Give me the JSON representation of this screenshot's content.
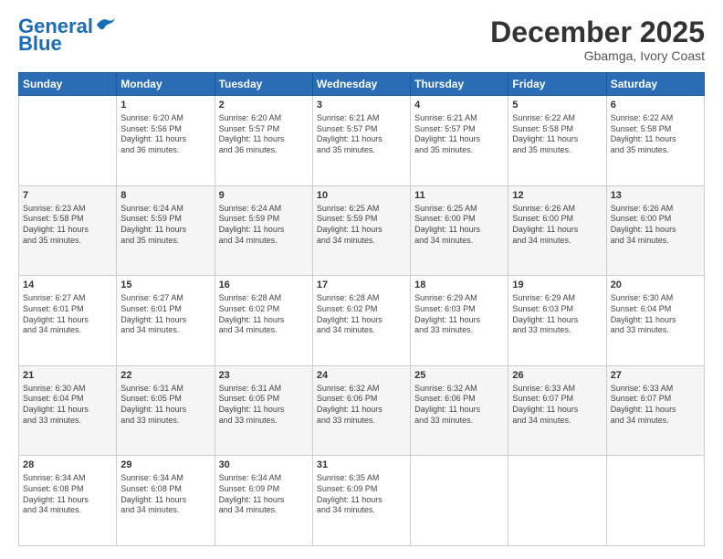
{
  "header": {
    "logo_line1": "General",
    "logo_line2": "Blue",
    "month": "December 2025",
    "location": "Gbamga, Ivory Coast"
  },
  "weekdays": [
    "Sunday",
    "Monday",
    "Tuesday",
    "Wednesday",
    "Thursday",
    "Friday",
    "Saturday"
  ],
  "weeks": [
    [
      {
        "day": "",
        "info": ""
      },
      {
        "day": "1",
        "info": "Sunrise: 6:20 AM\nSunset: 5:56 PM\nDaylight: 11 hours\nand 36 minutes."
      },
      {
        "day": "2",
        "info": "Sunrise: 6:20 AM\nSunset: 5:57 PM\nDaylight: 11 hours\nand 36 minutes."
      },
      {
        "day": "3",
        "info": "Sunrise: 6:21 AM\nSunset: 5:57 PM\nDaylight: 11 hours\nand 35 minutes."
      },
      {
        "day": "4",
        "info": "Sunrise: 6:21 AM\nSunset: 5:57 PM\nDaylight: 11 hours\nand 35 minutes."
      },
      {
        "day": "5",
        "info": "Sunrise: 6:22 AM\nSunset: 5:58 PM\nDaylight: 11 hours\nand 35 minutes."
      },
      {
        "day": "6",
        "info": "Sunrise: 6:22 AM\nSunset: 5:58 PM\nDaylight: 11 hours\nand 35 minutes."
      }
    ],
    [
      {
        "day": "7",
        "info": "Sunrise: 6:23 AM\nSunset: 5:58 PM\nDaylight: 11 hours\nand 35 minutes."
      },
      {
        "day": "8",
        "info": "Sunrise: 6:24 AM\nSunset: 5:59 PM\nDaylight: 11 hours\nand 35 minutes."
      },
      {
        "day": "9",
        "info": "Sunrise: 6:24 AM\nSunset: 5:59 PM\nDaylight: 11 hours\nand 34 minutes."
      },
      {
        "day": "10",
        "info": "Sunrise: 6:25 AM\nSunset: 5:59 PM\nDaylight: 11 hours\nand 34 minutes."
      },
      {
        "day": "11",
        "info": "Sunrise: 6:25 AM\nSunset: 6:00 PM\nDaylight: 11 hours\nand 34 minutes."
      },
      {
        "day": "12",
        "info": "Sunrise: 6:26 AM\nSunset: 6:00 PM\nDaylight: 11 hours\nand 34 minutes."
      },
      {
        "day": "13",
        "info": "Sunrise: 6:26 AM\nSunset: 6:00 PM\nDaylight: 11 hours\nand 34 minutes."
      }
    ],
    [
      {
        "day": "14",
        "info": "Sunrise: 6:27 AM\nSunset: 6:01 PM\nDaylight: 11 hours\nand 34 minutes."
      },
      {
        "day": "15",
        "info": "Sunrise: 6:27 AM\nSunset: 6:01 PM\nDaylight: 11 hours\nand 34 minutes."
      },
      {
        "day": "16",
        "info": "Sunrise: 6:28 AM\nSunset: 6:02 PM\nDaylight: 11 hours\nand 34 minutes."
      },
      {
        "day": "17",
        "info": "Sunrise: 6:28 AM\nSunset: 6:02 PM\nDaylight: 11 hours\nand 34 minutes."
      },
      {
        "day": "18",
        "info": "Sunrise: 6:29 AM\nSunset: 6:03 PM\nDaylight: 11 hours\nand 33 minutes."
      },
      {
        "day": "19",
        "info": "Sunrise: 6:29 AM\nSunset: 6:03 PM\nDaylight: 11 hours\nand 33 minutes."
      },
      {
        "day": "20",
        "info": "Sunrise: 6:30 AM\nSunset: 6:04 PM\nDaylight: 11 hours\nand 33 minutes."
      }
    ],
    [
      {
        "day": "21",
        "info": "Sunrise: 6:30 AM\nSunset: 6:04 PM\nDaylight: 11 hours\nand 33 minutes."
      },
      {
        "day": "22",
        "info": "Sunrise: 6:31 AM\nSunset: 6:05 PM\nDaylight: 11 hours\nand 33 minutes."
      },
      {
        "day": "23",
        "info": "Sunrise: 6:31 AM\nSunset: 6:05 PM\nDaylight: 11 hours\nand 33 minutes."
      },
      {
        "day": "24",
        "info": "Sunrise: 6:32 AM\nSunset: 6:06 PM\nDaylight: 11 hours\nand 33 minutes."
      },
      {
        "day": "25",
        "info": "Sunrise: 6:32 AM\nSunset: 6:06 PM\nDaylight: 11 hours\nand 33 minutes."
      },
      {
        "day": "26",
        "info": "Sunrise: 6:33 AM\nSunset: 6:07 PM\nDaylight: 11 hours\nand 34 minutes."
      },
      {
        "day": "27",
        "info": "Sunrise: 6:33 AM\nSunset: 6:07 PM\nDaylight: 11 hours\nand 34 minutes."
      }
    ],
    [
      {
        "day": "28",
        "info": "Sunrise: 6:34 AM\nSunset: 6:08 PM\nDaylight: 11 hours\nand 34 minutes."
      },
      {
        "day": "29",
        "info": "Sunrise: 6:34 AM\nSunset: 6:08 PM\nDaylight: 11 hours\nand 34 minutes."
      },
      {
        "day": "30",
        "info": "Sunrise: 6:34 AM\nSunset: 6:09 PM\nDaylight: 11 hours\nand 34 minutes."
      },
      {
        "day": "31",
        "info": "Sunrise: 6:35 AM\nSunset: 6:09 PM\nDaylight: 11 hours\nand 34 minutes."
      },
      {
        "day": "",
        "info": ""
      },
      {
        "day": "",
        "info": ""
      },
      {
        "day": "",
        "info": ""
      }
    ]
  ]
}
